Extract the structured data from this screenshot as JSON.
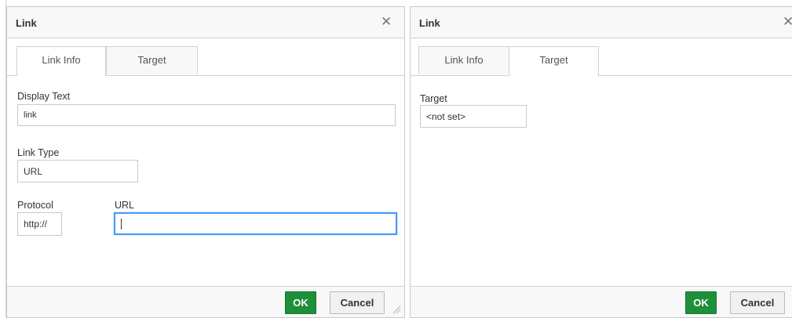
{
  "left_dialog": {
    "title": "Link",
    "close_glyph": "✕",
    "tabs": [
      {
        "label": "Link Info",
        "active": true
      },
      {
        "label": "Target",
        "active": false
      }
    ],
    "display_text": {
      "label": "Display Text",
      "value": "link"
    },
    "link_type": {
      "label": "Link Type",
      "value": "URL"
    },
    "protocol": {
      "label": "Protocol",
      "value": "http://"
    },
    "url": {
      "label": "URL",
      "value": ""
    },
    "ok_label": "OK",
    "cancel_label": "Cancel"
  },
  "right_dialog": {
    "title": "Link",
    "close_glyph": "✕",
    "tabs": [
      {
        "label": "Link Info",
        "active": false
      },
      {
        "label": "Target",
        "active": true
      }
    ],
    "target": {
      "label": "Target",
      "value": "<not set>"
    },
    "ok_label": "OK",
    "cancel_label": "Cancel"
  },
  "colors": {
    "ok_button": "#1e8f3b",
    "focus_border": "#419bf9",
    "chrome_background": "#f8f8f8"
  }
}
